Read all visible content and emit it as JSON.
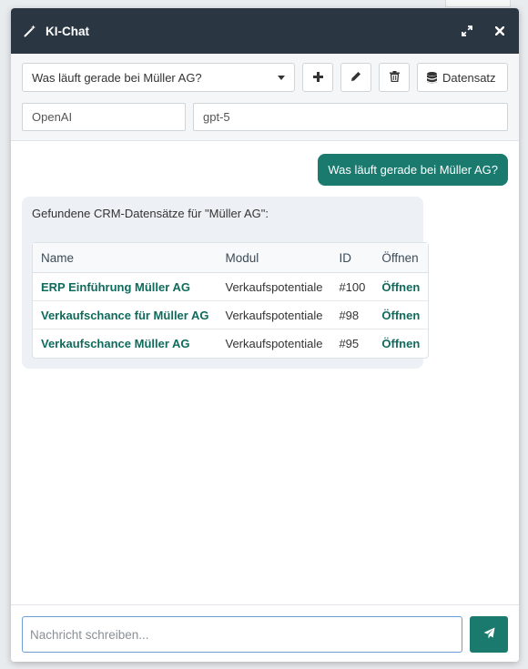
{
  "window": {
    "title": "KI-Chat",
    "icons": {
      "title": "magic-wand-icon",
      "expand": "expand-icon",
      "close": "close-icon"
    }
  },
  "toolbar": {
    "conversation_select": "Was läuft gerade bei Müller AG?",
    "add_icon": "plus-icon",
    "edit_icon": "pencil-icon",
    "delete_icon": "trash-icon",
    "dataset_label": "Datensatz",
    "dataset_icon": "database-icon",
    "provider": "OpenAI",
    "model": "gpt-5"
  },
  "chat": {
    "user_message": "Was läuft gerade bei Müller AG?",
    "bot_intro": "Gefundene CRM-Datensätze für \"Müller AG\":",
    "table": {
      "headers": [
        "Name",
        "Modul",
        "ID",
        "Öffnen"
      ],
      "rows": [
        {
          "name": "ERP Einführung Müller AG",
          "module": "Verkaufspotentiale",
          "id": "#100",
          "open": "Öffnen"
        },
        {
          "name": "Verkaufschance für Müller AG",
          "module": "Verkaufspotentiale",
          "id": "#98",
          "open": "Öffnen"
        },
        {
          "name": "Verkaufschance Müller AG",
          "module": "Verkaufspotentiale",
          "id": "#95",
          "open": "Öffnen"
        }
      ]
    }
  },
  "composer": {
    "placeholder": "Nachricht schreiben...",
    "value": "",
    "send_icon": "paper-plane-icon"
  },
  "colors": {
    "titlebar": "#2b3643",
    "accent": "#1a7a6e",
    "link": "#0f6b5c",
    "bot_bubble": "#edf1f5"
  }
}
